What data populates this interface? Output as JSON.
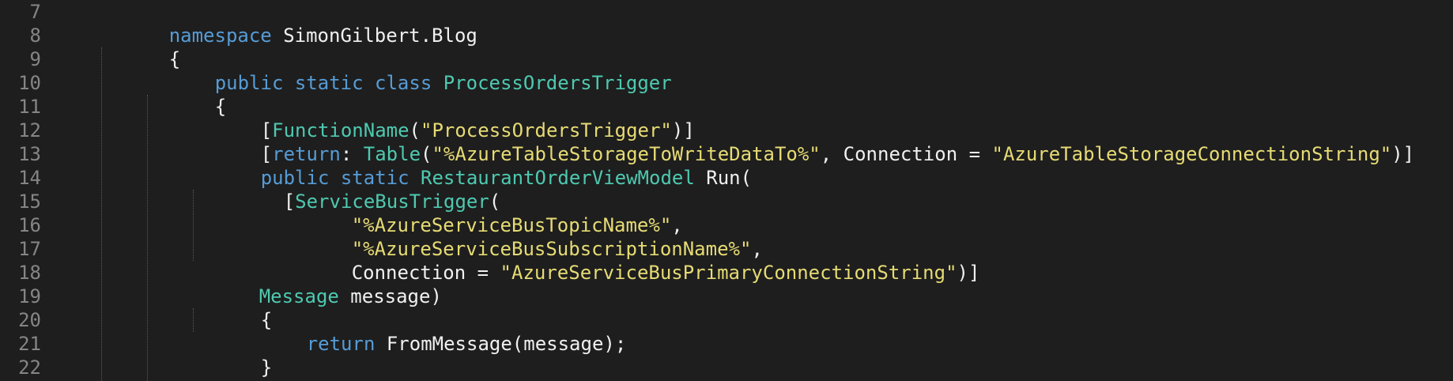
{
  "editor": {
    "line_numbers": [
      "7",
      "8",
      "9",
      "10",
      "11",
      "12",
      "13",
      "14",
      "15",
      "16",
      "17",
      "18",
      "19",
      "20",
      "21",
      "22"
    ],
    "tokens": {
      "namespace_kw": "namespace",
      "namespace_name": " SimonGilbert.Blog",
      "brace_open": "{",
      "brace_close": "}",
      "public_kw": "public",
      "static_kw": "static",
      "class_kw": "class",
      "class_name": "ProcessOrdersTrigger",
      "bracket_open": "[",
      "function_name_attr": "FunctionName",
      "paren_open": "(",
      "str_process_orders": "\"ProcessOrdersTrigger\"",
      "paren_bracket_close": ")]",
      "return_kw": "return",
      "colon_space": ": ",
      "table_attr": "Table",
      "str_table_storage": "\"%AzureTableStorageToWriteDataTo%\"",
      "connection_assign": ", Connection = ",
      "str_table_conn": "\"AzureTableStorageConnectionString\"",
      "restaurant_vm": "RestaurantOrderViewModel",
      "run_open": " Run(",
      "service_bus_trigger": "ServiceBusTrigger",
      "str_topic": "\"%AzureServiceBusTopicName%\"",
      "comma": ",",
      "str_subscription": "\"%AzureServiceBusSubscriptionName%\"",
      "connection_assign2": "Connection = ",
      "str_bus_conn": "\"AzureServiceBusPrimaryConnectionString\"",
      "message_type": "Message",
      "message_param": " message)",
      "from_message": " FromMessage(message);"
    }
  }
}
